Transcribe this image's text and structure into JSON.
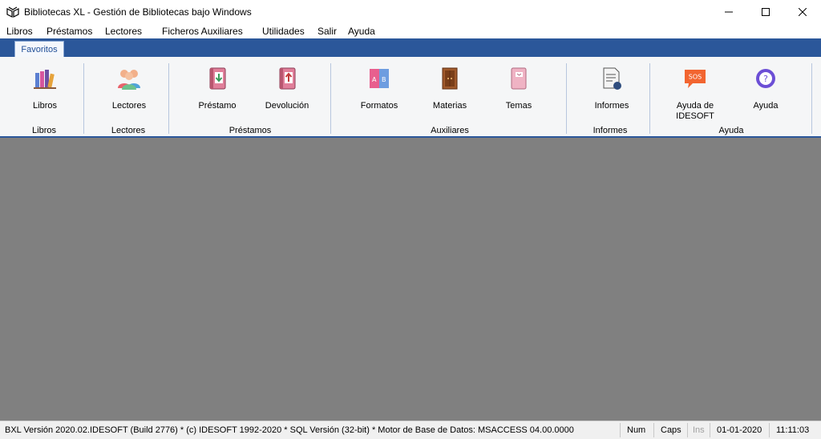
{
  "window": {
    "title": "Bibliotecas XL - Gestión de Bibliotecas bajo Windows",
    "icon": "book-open-icon"
  },
  "menu": [
    {
      "label": "Libros"
    },
    {
      "label": "Préstamos"
    },
    {
      "label": "Lectores"
    },
    {
      "label": "Ficheros Auxiliares"
    },
    {
      "label": "Utilidades"
    },
    {
      "label": "Salir"
    },
    {
      "label": "Ayuda"
    }
  ],
  "ribbon": {
    "tab": "Favoritos",
    "buttons": {
      "libros": "Libros",
      "lectores": "Lectores",
      "prestamo": "Préstamo",
      "devolucion": "Devolución",
      "formatos": "Formatos",
      "materias": "Materias",
      "temas": "Temas",
      "informes": "Informes",
      "ayuda_idesoft_1": "Ayuda de",
      "ayuda_idesoft_2": "IDESOFT",
      "ayuda": "Ayuda"
    },
    "groups": {
      "libros": "Libros",
      "lectores": "Lectores",
      "prestamos": "Préstamos",
      "auxiliares": "Auxiliares",
      "informes": "Informes",
      "ayuda": "Ayuda"
    },
    "sos_text": "SOS"
  },
  "status": {
    "info": "BXL Versión 2020.02.IDESOFT  (Build 2776) * (c) IDESOFT 1992-2020 *  SQL Versión (32-bit) * Motor de Base de Datos: MSACCESS 04.00.0000",
    "num": "Num",
    "caps": "Caps",
    "ins": "Ins",
    "date": "01-01-2020",
    "time": "11:11:03"
  }
}
